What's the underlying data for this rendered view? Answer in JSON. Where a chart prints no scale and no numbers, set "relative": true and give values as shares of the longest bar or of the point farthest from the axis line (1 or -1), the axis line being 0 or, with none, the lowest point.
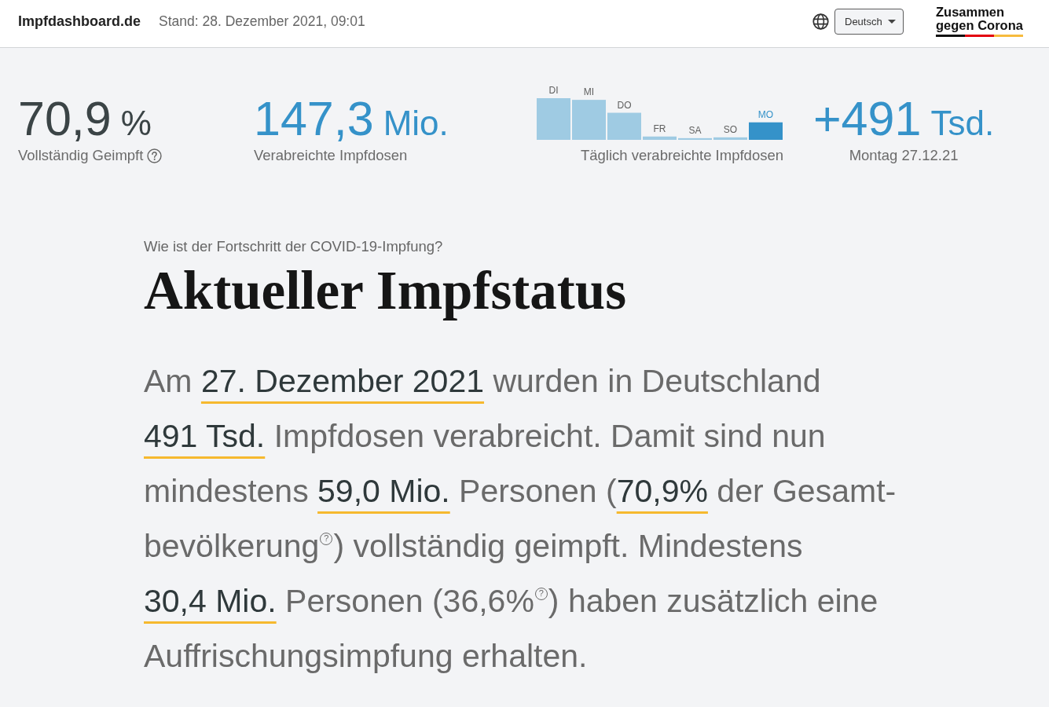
{
  "header": {
    "site_name": "Impfdashboard.de",
    "updated": "Stand: 28. Dezember 2021, 09:01",
    "language": {
      "value": "Deutsch"
    },
    "logo": "Zusammen gegen Corona"
  },
  "stats": [
    {
      "kind": "figure",
      "value": "70,9",
      "unit": "%",
      "label": "Vollständig Geimpft",
      "help": true,
      "color": "#3b4446"
    },
    {
      "kind": "figure",
      "value": "147,3",
      "unit": "Mio.",
      "label": "Verabreichte Impfdosen",
      "help": false,
      "color": "#3592c9"
    },
    {
      "kind": "chart",
      "label": "Täglich verabreichte Impfdosen",
      "chart_data": {
        "type": "bar",
        "categories": [
          "DI",
          "MI",
          "DO",
          "FR",
          "SA",
          "SO",
          "MO"
        ],
        "series": [
          {
            "color": "#9fcbe3",
            "values": [
              1.0,
              0.96,
              0.65,
              0.08,
              0.04,
              0.06,
              0
            ]
          },
          {
            "color": "#3592c9",
            "values": [
              0,
              0,
              0,
              0,
              0,
              0,
              0.42
            ]
          }
        ],
        "stacked": true,
        "relative": true
      }
    },
    {
      "kind": "figure",
      "value": "+491",
      "unit": "Tsd.",
      "label": "Montag 27.12.21",
      "help": false,
      "color": "#3592c9"
    }
  ],
  "intro": {
    "kicker": "Wie ist der Fortschritt der COVID-19-Impfung?",
    "title": "Aktueller Impfstatus",
    "summary": [
      {
        "text": "Am ",
        "highlighted": false
      },
      {
        "text": "27. Dezember 2021",
        "highlighted": true
      },
      {
        "text": " wurden in Deutschland ",
        "highlighted": false
      },
      {
        "text": "491 Tsd.",
        "highlighted": true
      },
      {
        "text": " Impfdosen verabreicht. Damit sind nun mindestens ",
        "highlighted": false
      },
      {
        "text": "59,0 Mio.",
        "highlighted": true
      },
      {
        "text": " Personen (",
        "highlighted": false
      },
      {
        "text": "70,9%",
        "highlighted": true
      },
      {
        "text": " der Gesamt-bevölkerung$^{?}$) vollständig geimpft. Mindestens ",
        "highlighted": false
      },
      {
        "text": "30,4 Mio.",
        "highlighted": true
      },
      {
        "text": " Personen (36,6%$^{?}$) haben zusätzlich eine Auffrischungsimpfung erhalten.",
        "highlighted": false
      }
    ]
  }
}
